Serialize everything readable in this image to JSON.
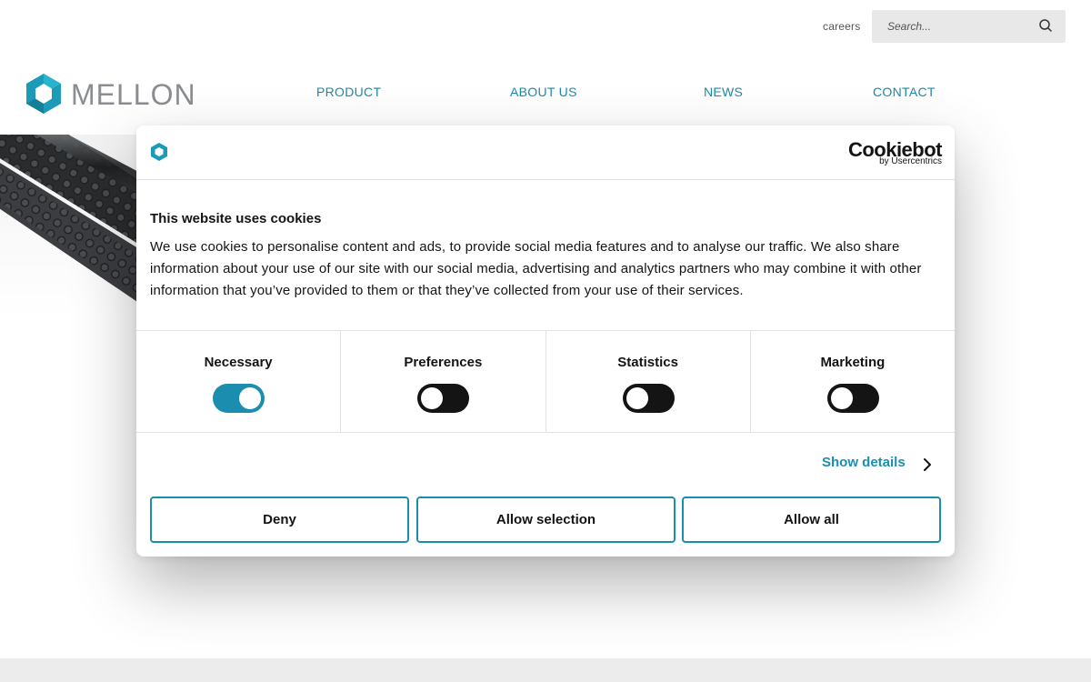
{
  "header": {
    "careers_label": "careers",
    "search_placeholder": "Search...",
    "logo_text": "MELLON",
    "nav": [
      "PRODUCT",
      "ABOUT US",
      "NEWS",
      "CONTACT"
    ]
  },
  "cookie_dialog": {
    "brand_name": "Cookiebot",
    "brand_sub": "by Usercentrics",
    "title": "This website uses cookies",
    "text": "We use cookies to personalise content and ads, to provide social media features and to analyse our traffic. We also share information about your use of our site with our social media, advertising and analytics partners who may combine it with other information that you’ve provided to them or that they’ve collected from your use of their services.",
    "categories": [
      {
        "label": "Necessary",
        "enabled": true
      },
      {
        "label": "Preferences",
        "enabled": false
      },
      {
        "label": "Statistics",
        "enabled": false
      },
      {
        "label": "Marketing",
        "enabled": false
      }
    ],
    "show_details_label": "Show details",
    "buttons": {
      "deny": "Deny",
      "allow_selection": "Allow selection",
      "allow_all": "Allow all"
    }
  },
  "colors": {
    "accent": "#1b8eb0",
    "nav_text": "#1c8ba6",
    "logo_grey": "#8a8e92",
    "switch_off": "#141414"
  },
  "icons": {
    "search": "search-icon",
    "show_details": "chevron-right-icon",
    "logo": "hexagon-logo-icon"
  }
}
